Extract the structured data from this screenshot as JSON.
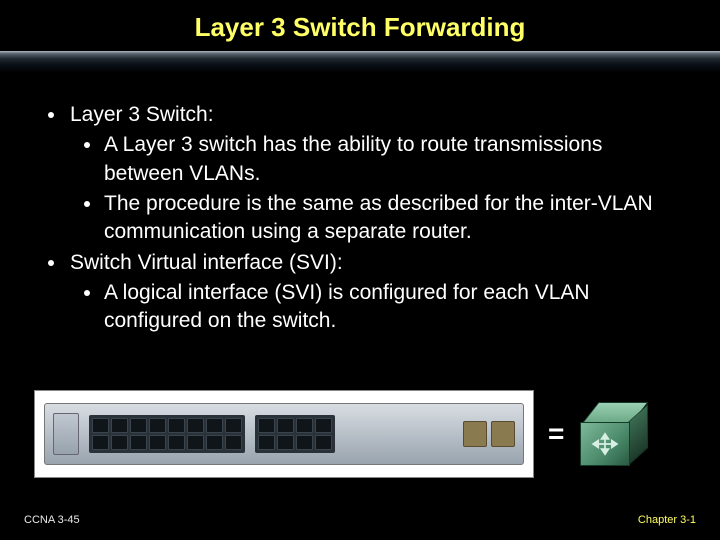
{
  "title": "Layer 3 Switch Forwarding",
  "bullets": {
    "b1": "Layer 3 Switch:",
    "b1a": "A Layer 3 switch has the ability to route transmissions between VLANs.",
    "b1b": "The procedure is the same as described for the inter-VLAN communication using a separate router.",
    "b2": "Switch Virtual interface (SVI):",
    "b2a": "A logical interface (SVI) is configured for each VLAN configured on the switch."
  },
  "diagram": {
    "equals": "="
  },
  "footer": {
    "left": "CCNA 3-45",
    "right": "Chapter 3-1"
  }
}
